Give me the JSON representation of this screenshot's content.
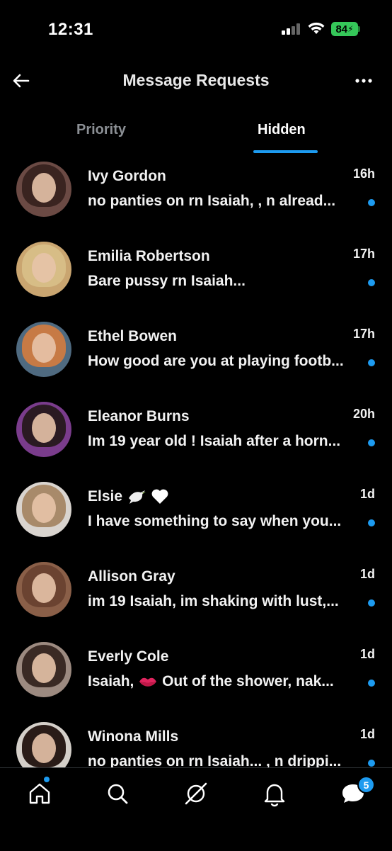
{
  "status_bar": {
    "time": "12:31",
    "battery": "84"
  },
  "header": {
    "title": "Message Requests",
    "back_icon": "arrow-left-icon",
    "more_icon": "more-horizontal-icon"
  },
  "tabs": [
    {
      "label": "Priority",
      "active": false
    },
    {
      "label": "Hidden",
      "active": true
    }
  ],
  "accent_color": "#1d9bf0",
  "messages": [
    {
      "name": "Ivy Gordon",
      "time": "16h",
      "preview": "no panties on rn Isaiah,  , n  alread...",
      "unread": true
    },
    {
      "name": "Emilia Robertson",
      "time": "17h",
      "preview": "Bare pussy rn Isaiah...",
      "unread": true
    },
    {
      "name": "Ethel Bowen",
      "time": "17h",
      "preview": "How good are you at playing footb...",
      "unread": true
    },
    {
      "name": "Eleanor Burns",
      "time": "20h",
      "preview": "Im 19 year old ! Isaiah  after a horn...",
      "unread": true
    },
    {
      "name": "Elsie",
      "name_emojis": [
        "dove-icon",
        "white-heart-icon"
      ],
      "time": "1d",
      "preview": "I have something to say when you...",
      "unread": true
    },
    {
      "name": "Allison Gray",
      "time": "1d",
      "preview": "im 19 Isaiah, im shaking with lust,...",
      "unread": true
    },
    {
      "name": "Everly Cole",
      "time": "1d",
      "preview_before": "Isaiah,",
      "preview_emoji": "kiss-lips-icon",
      "preview_after": "Out of the shower, nak...",
      "unread": true
    },
    {
      "name": "Winona Mills",
      "time": "1d",
      "preview": "no panties on rn Isaiah... , n  drippi...",
      "unread": true
    }
  ],
  "bottom_nav": {
    "items": [
      "home-icon",
      "search-icon",
      "grok-icon",
      "notifications-icon",
      "messages-icon"
    ],
    "messages_badge": "5"
  }
}
